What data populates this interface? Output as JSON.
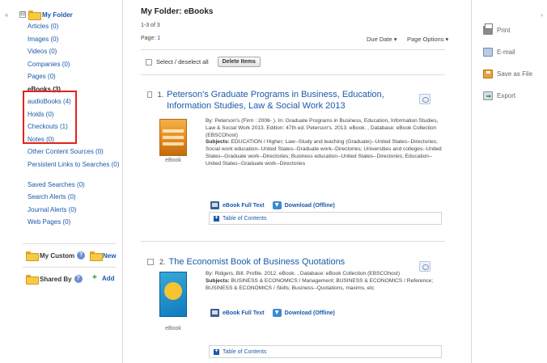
{
  "sidebar": {
    "collapse": "«",
    "expand_symbol": "⊟",
    "root_label": "My Folder",
    "items": [
      {
        "label": "Articles (0)"
      },
      {
        "label": "Images (0)"
      },
      {
        "label": "Videos (0)"
      },
      {
        "label": "Companies (0)"
      },
      {
        "label": "Pages (0)"
      },
      {
        "label": "eBooks (3)",
        "selected": true
      },
      {
        "label": "audioBooks (4)"
      },
      {
        "label": "Holds (0)"
      },
      {
        "label": "Checkouts (1)"
      },
      {
        "label": "Notes (0)"
      },
      {
        "label": "Other Content Sources (0)"
      },
      {
        "label": "Persistent Links to Searches (0)"
      },
      {
        "label": "Saved Searches (0)"
      },
      {
        "label": "Search Alerts (0)"
      },
      {
        "label": "Journal Alerts (0)"
      },
      {
        "label": "Web Pages (0)"
      }
    ],
    "my_custom": "My Custom",
    "new": "New",
    "shared_by": "Shared By",
    "add": "Add",
    "help_symbol": "?"
  },
  "main": {
    "title": "My Folder: eBooks",
    "count": "1-3 of 3",
    "page_label": "Page:",
    "page_num": "1",
    "sort": "Due Date ▾",
    "options": "Page Options ▾",
    "select_all": "Select / deselect all",
    "delete_btn": "Delete Items",
    "results": [
      {
        "num": "1.",
        "title": "Peterson's Graduate Programs in Business, Education, Information Studies, Law & Social Work 2013",
        "type": "eBook",
        "line1": "By: Peterson's (Firm : 2006- ). In: Graduate Programs in Business, Education, Information Studies, Law & Social Work 2013. Edition: 47th ed. Peterson's. 2013. eBook. , Database: eBook Collection (EBSCOhost)",
        "subjects_label": "Subjects:",
        "subjects": " EDUCATION / Higher; Law--Study and teaching (Graduate)--United States--Directories; Social work education--United States--Graduate work--Directories; Universities and colleges--United States--Graduate work--Directories; Business education--United States--Directories; Education--United States--Graduate work--Directories",
        "full_text": "eBook Full Text",
        "download": "Download (Offline)",
        "toc": "Table of Contents"
      },
      {
        "num": "2.",
        "title": "The Economist Book of Business Quotations",
        "type": "eBook",
        "line1": "By: Ridgers, Bill. Profile. 2012. eBook. , Database: eBook Collection (EBSCOhost)",
        "subjects_label": "Subjects:",
        "subjects": " BUSINESS & ECONOMICS / Management; BUSINESS & ECONOMICS / Reference; BUSINESS & ECONOMICS / Skills; Business--Quotations, maxims, etc",
        "full_text": "eBook Full Text",
        "download": "Download (Offline)",
        "toc": "Table of Contents"
      }
    ]
  },
  "tools": {
    "collapse": "›",
    "print": "Print",
    "email": "E-mail",
    "save": "Save as File",
    "export": "Export"
  }
}
